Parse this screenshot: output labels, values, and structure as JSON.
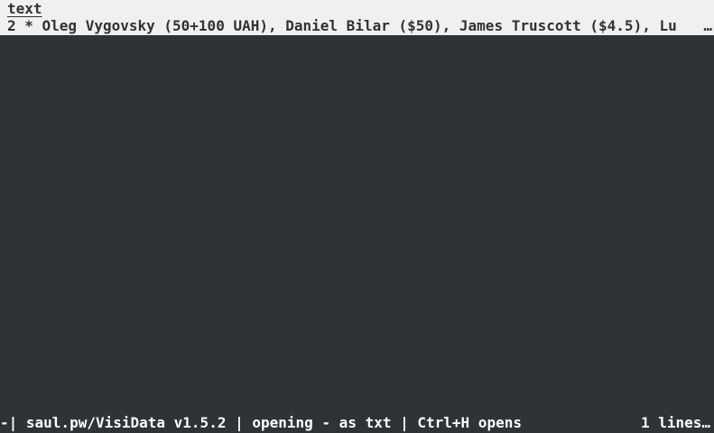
{
  "sheet": {
    "column_header": "text",
    "rows": [
      {
        "text": "2 * Oleg Vygovsky (50+100 UAH), Daniel Bilar ($50), James Truscott ($4.5), Lu",
        "overflow_marker": "…"
      }
    ]
  },
  "status": {
    "left": "-| saul.pw/VisiData v1.5.2 | opening - as txt | Ctrl+H opens",
    "right": "1 lines…"
  },
  "colors": {
    "background": "#2f3335",
    "row_highlight": "#f0f0f0",
    "text_dark": "#2f3335",
    "text_light": "#ffffff"
  }
}
